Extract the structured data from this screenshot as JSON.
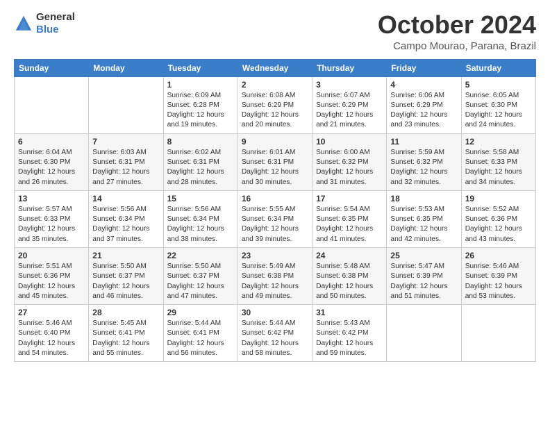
{
  "header": {
    "logo_line1": "General",
    "logo_line2": "Blue",
    "month_title": "October 2024",
    "location": "Campo Mourao, Parana, Brazil"
  },
  "days_of_week": [
    "Sunday",
    "Monday",
    "Tuesday",
    "Wednesday",
    "Thursday",
    "Friday",
    "Saturday"
  ],
  "weeks": [
    [
      {
        "num": "",
        "info": ""
      },
      {
        "num": "",
        "info": ""
      },
      {
        "num": "1",
        "info": "Sunrise: 6:09 AM\nSunset: 6:28 PM\nDaylight: 12 hours\nand 19 minutes."
      },
      {
        "num": "2",
        "info": "Sunrise: 6:08 AM\nSunset: 6:29 PM\nDaylight: 12 hours\nand 20 minutes."
      },
      {
        "num": "3",
        "info": "Sunrise: 6:07 AM\nSunset: 6:29 PM\nDaylight: 12 hours\nand 21 minutes."
      },
      {
        "num": "4",
        "info": "Sunrise: 6:06 AM\nSunset: 6:29 PM\nDaylight: 12 hours\nand 23 minutes."
      },
      {
        "num": "5",
        "info": "Sunrise: 6:05 AM\nSunset: 6:30 PM\nDaylight: 12 hours\nand 24 minutes."
      }
    ],
    [
      {
        "num": "6",
        "info": "Sunrise: 6:04 AM\nSunset: 6:30 PM\nDaylight: 12 hours\nand 26 minutes."
      },
      {
        "num": "7",
        "info": "Sunrise: 6:03 AM\nSunset: 6:31 PM\nDaylight: 12 hours\nand 27 minutes."
      },
      {
        "num": "8",
        "info": "Sunrise: 6:02 AM\nSunset: 6:31 PM\nDaylight: 12 hours\nand 28 minutes."
      },
      {
        "num": "9",
        "info": "Sunrise: 6:01 AM\nSunset: 6:31 PM\nDaylight: 12 hours\nand 30 minutes."
      },
      {
        "num": "10",
        "info": "Sunrise: 6:00 AM\nSunset: 6:32 PM\nDaylight: 12 hours\nand 31 minutes."
      },
      {
        "num": "11",
        "info": "Sunrise: 5:59 AM\nSunset: 6:32 PM\nDaylight: 12 hours\nand 32 minutes."
      },
      {
        "num": "12",
        "info": "Sunrise: 5:58 AM\nSunset: 6:33 PM\nDaylight: 12 hours\nand 34 minutes."
      }
    ],
    [
      {
        "num": "13",
        "info": "Sunrise: 5:57 AM\nSunset: 6:33 PM\nDaylight: 12 hours\nand 35 minutes."
      },
      {
        "num": "14",
        "info": "Sunrise: 5:56 AM\nSunset: 6:34 PM\nDaylight: 12 hours\nand 37 minutes."
      },
      {
        "num": "15",
        "info": "Sunrise: 5:56 AM\nSunset: 6:34 PM\nDaylight: 12 hours\nand 38 minutes."
      },
      {
        "num": "16",
        "info": "Sunrise: 5:55 AM\nSunset: 6:34 PM\nDaylight: 12 hours\nand 39 minutes."
      },
      {
        "num": "17",
        "info": "Sunrise: 5:54 AM\nSunset: 6:35 PM\nDaylight: 12 hours\nand 41 minutes."
      },
      {
        "num": "18",
        "info": "Sunrise: 5:53 AM\nSunset: 6:35 PM\nDaylight: 12 hours\nand 42 minutes."
      },
      {
        "num": "19",
        "info": "Sunrise: 5:52 AM\nSunset: 6:36 PM\nDaylight: 12 hours\nand 43 minutes."
      }
    ],
    [
      {
        "num": "20",
        "info": "Sunrise: 5:51 AM\nSunset: 6:36 PM\nDaylight: 12 hours\nand 45 minutes."
      },
      {
        "num": "21",
        "info": "Sunrise: 5:50 AM\nSunset: 6:37 PM\nDaylight: 12 hours\nand 46 minutes."
      },
      {
        "num": "22",
        "info": "Sunrise: 5:50 AM\nSunset: 6:37 PM\nDaylight: 12 hours\nand 47 minutes."
      },
      {
        "num": "23",
        "info": "Sunrise: 5:49 AM\nSunset: 6:38 PM\nDaylight: 12 hours\nand 49 minutes."
      },
      {
        "num": "24",
        "info": "Sunrise: 5:48 AM\nSunset: 6:38 PM\nDaylight: 12 hours\nand 50 minutes."
      },
      {
        "num": "25",
        "info": "Sunrise: 5:47 AM\nSunset: 6:39 PM\nDaylight: 12 hours\nand 51 minutes."
      },
      {
        "num": "26",
        "info": "Sunrise: 5:46 AM\nSunset: 6:39 PM\nDaylight: 12 hours\nand 53 minutes."
      }
    ],
    [
      {
        "num": "27",
        "info": "Sunrise: 5:46 AM\nSunset: 6:40 PM\nDaylight: 12 hours\nand 54 minutes."
      },
      {
        "num": "28",
        "info": "Sunrise: 5:45 AM\nSunset: 6:41 PM\nDaylight: 12 hours\nand 55 minutes."
      },
      {
        "num": "29",
        "info": "Sunrise: 5:44 AM\nSunset: 6:41 PM\nDaylight: 12 hours\nand 56 minutes."
      },
      {
        "num": "30",
        "info": "Sunrise: 5:44 AM\nSunset: 6:42 PM\nDaylight: 12 hours\nand 58 minutes."
      },
      {
        "num": "31",
        "info": "Sunrise: 5:43 AM\nSunset: 6:42 PM\nDaylight: 12 hours\nand 59 minutes."
      },
      {
        "num": "",
        "info": ""
      },
      {
        "num": "",
        "info": ""
      }
    ]
  ]
}
